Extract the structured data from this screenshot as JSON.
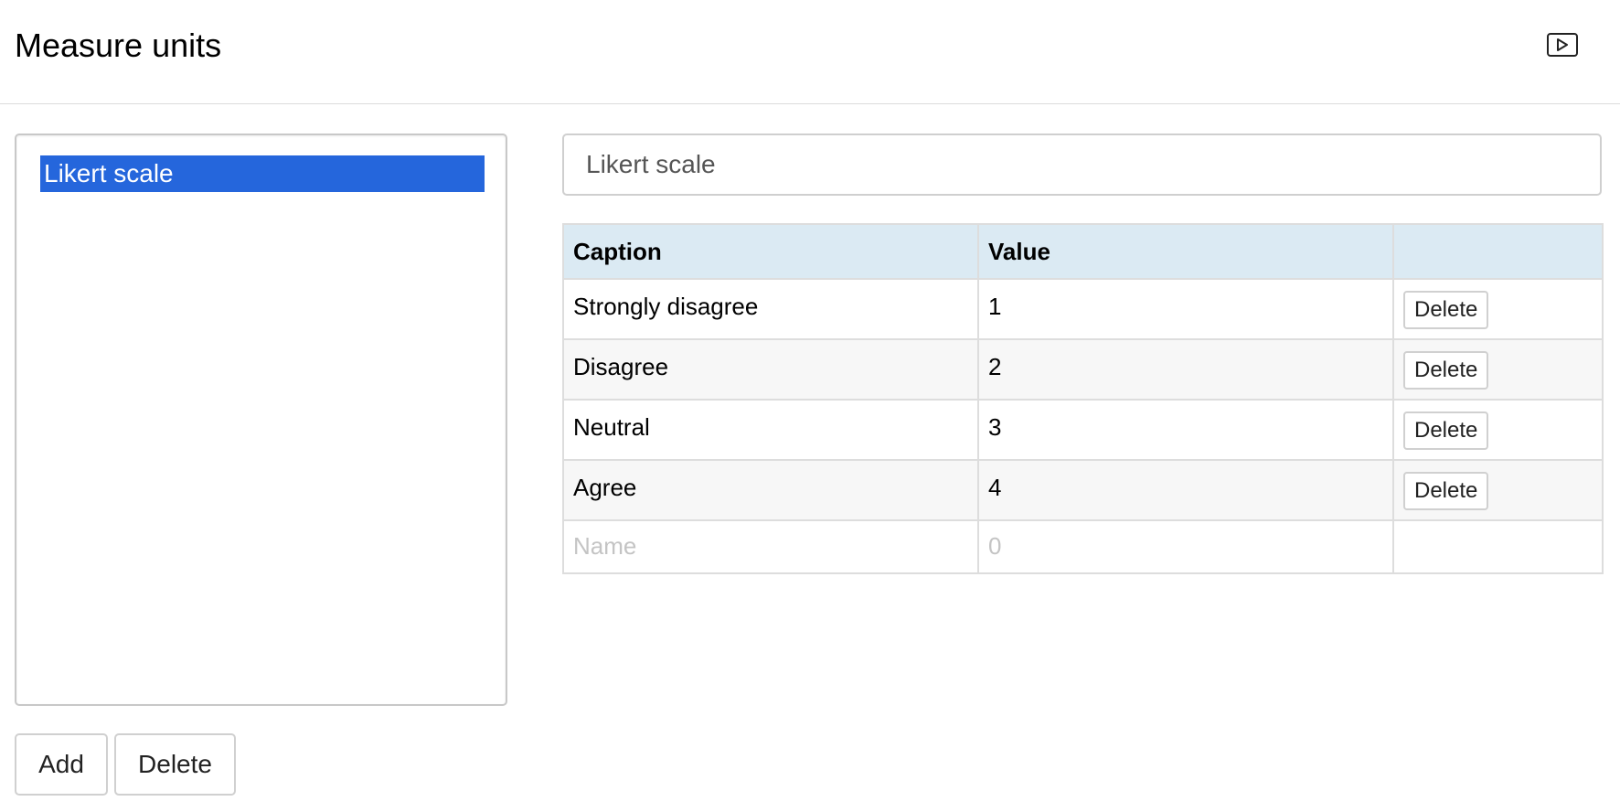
{
  "header": {
    "title": "Measure units",
    "video_icon": "play-video-icon"
  },
  "list": {
    "items": [
      {
        "label": "Likert scale",
        "selected": true
      }
    ]
  },
  "list_actions": {
    "add_label": "Add",
    "delete_label": "Delete"
  },
  "editor": {
    "name_value": "Likert scale",
    "table": {
      "headers": {
        "caption": "Caption",
        "value": "Value",
        "actions": ""
      },
      "rows": [
        {
          "caption": "Strongly disagree",
          "value": "1",
          "delete_label": "Delete"
        },
        {
          "caption": "Disagree",
          "value": "2",
          "delete_label": "Delete"
        },
        {
          "caption": "Neutral",
          "value": "3",
          "delete_label": "Delete"
        },
        {
          "caption": "Agree",
          "value": "4",
          "delete_label": "Delete"
        }
      ],
      "new_row": {
        "caption_placeholder": "Name",
        "value_placeholder": "0"
      }
    }
  },
  "colors": {
    "selection": "#2566dc",
    "table_header": "#dbeaf3"
  }
}
